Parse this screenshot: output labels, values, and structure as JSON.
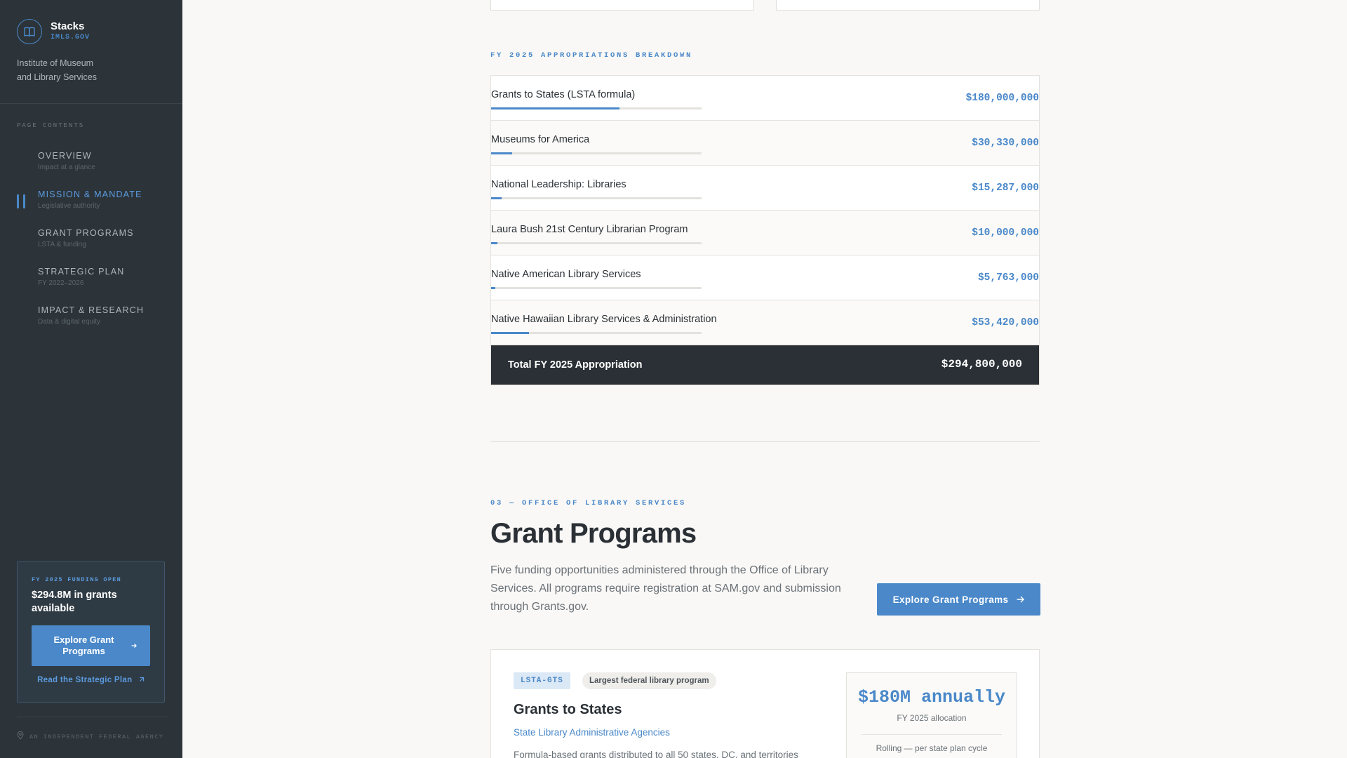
{
  "sidebar": {
    "brand_name": "Stacks",
    "brand_domain": "IMLS.GOV",
    "agency_line1": "Institute of Museum",
    "agency_line2": "and Library Services",
    "contents_label": "PAGE CONTENTS",
    "nav": [
      {
        "title": "OVERVIEW",
        "sub": "Impact at a glance",
        "active": false
      },
      {
        "title": "MISSION & MANDATE",
        "sub": "Legislative authority",
        "active": true
      },
      {
        "title": "GRANT PROGRAMS",
        "sub": "LSTA & funding",
        "active": false
      },
      {
        "title": "STRATEGIC PLAN",
        "sub": "FY 2022–2026",
        "active": false
      },
      {
        "title": "IMPACT & RESEARCH",
        "sub": "Data & digital equity",
        "active": false
      }
    ],
    "cta": {
      "kicker": "FY 2025 FUNDING OPEN",
      "title": "$294.8M in grants available",
      "button": "Explore Grant Programs",
      "link": "Read the Strategic Plan"
    },
    "footer": "AN INDEPENDENT FEDERAL AGENCY"
  },
  "appropriations": {
    "kicker": "FY 2025 APPROPRIATIONS BREAKDOWN",
    "rows": [
      {
        "label": "Grants to States (LSTA formula)",
        "value": "$180,000,000",
        "share": 0.61
      },
      {
        "label": "Museums for America",
        "value": "$30,330,000",
        "share": 0.1
      },
      {
        "label": "National Leadership: Libraries",
        "value": "$15,287,000",
        "share": 0.05
      },
      {
        "label": "Laura Bush 21st Century Librarian Program",
        "value": "$10,000,000",
        "share": 0.03
      },
      {
        "label": "Native American Library Services",
        "value": "$5,763,000",
        "share": 0.02
      },
      {
        "label": "Native Hawaiian Library Services & Administration",
        "value": "$53,420,000",
        "share": 0.18
      }
    ],
    "total_label": "Total FY 2025 Appropriation",
    "total_value": "$294,800,000"
  },
  "grant_programs": {
    "kicker": "03 — OFFICE OF LIBRARY SERVICES",
    "title": "Grant Programs",
    "description": "Five funding opportunities administered through the Office of Library Services. All programs require registration at SAM.gov and submission through Grants.gov.",
    "button": "Explore Grant Programs"
  },
  "program_card": {
    "code": "LSTA-GTS",
    "note": "Largest federal library program",
    "title": "Grants to States",
    "link": "State Library Administrative Agencies",
    "description": "Formula-based grants distributed to all 50 states, DC, and territories",
    "stat_big": "$180M annually",
    "stat_sub": "FY 2025 allocation",
    "stat_cycle": "Rolling — per state plan cycle"
  },
  "colors": {
    "accent": "#4a88c9",
    "sidebar_bg": "#2c3439",
    "dark": "#2a3035"
  }
}
